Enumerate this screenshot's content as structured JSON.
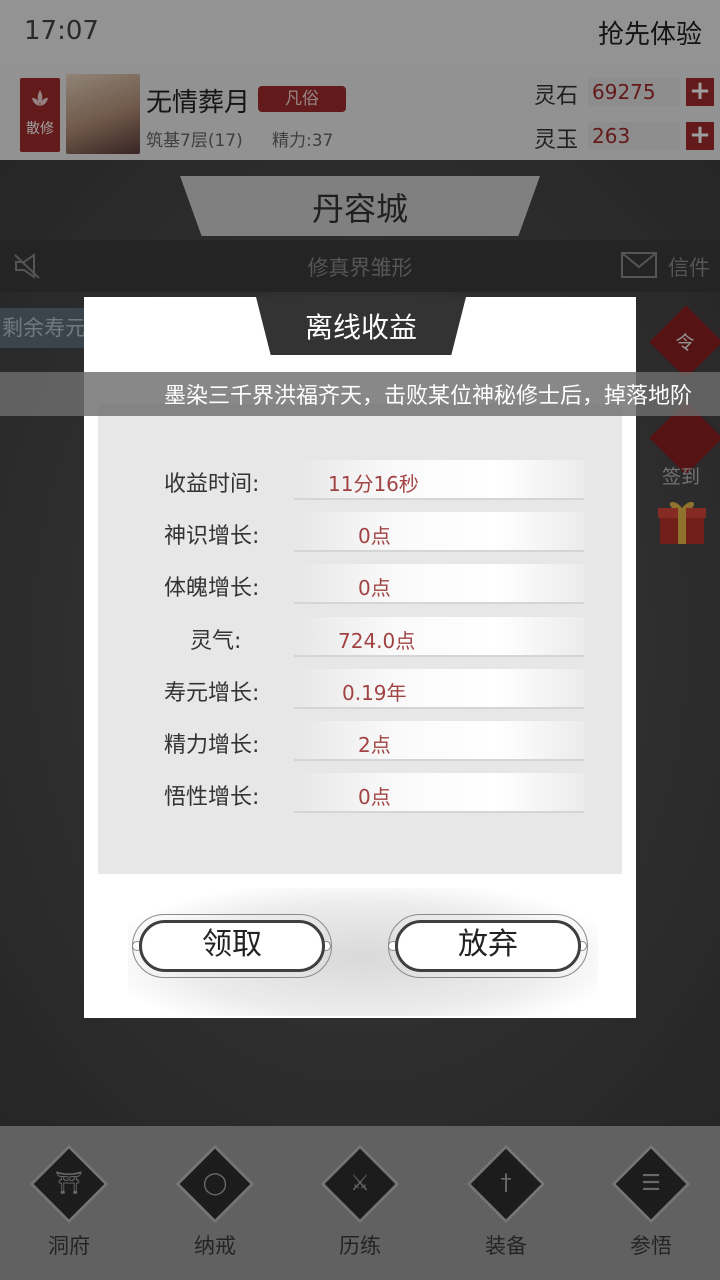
{
  "status_bar": {
    "time": "17:07",
    "preview_label": "抢先体验"
  },
  "player": {
    "sect": "散修",
    "name": "无情葬月",
    "rank": "凡俗",
    "realm": "筑基7层(17)",
    "energy": "精力:37"
  },
  "currency": {
    "stone_label": "灵石",
    "stone_value": "69275",
    "jade_label": "灵玉",
    "jade_value": "263",
    "add_symbol": "+"
  },
  "map": {
    "city_name": "丹容城",
    "news_title": "修真界雏形",
    "mail_label": "信件",
    "life_tag": "剩余寿元",
    "side_order": "令",
    "side_checkin": "签到"
  },
  "ticker": {
    "text": "墨染三千界洪福齐天，击败某位神秘修士后，掉落地阶"
  },
  "dialog": {
    "title": "离线收益",
    "rows": [
      {
        "label": "收益时间:",
        "value": "11分16秒"
      },
      {
        "label": "神识增长:",
        "value": "0点"
      },
      {
        "label": "体魄增长:",
        "value": "0点"
      },
      {
        "label": "灵气:",
        "value": "724.0点"
      },
      {
        "label": "寿元增长:",
        "value": "0.19年"
      },
      {
        "label": "精力增长:",
        "value": "2点"
      },
      {
        "label": "悟性增长:",
        "value": "0点"
      }
    ],
    "claim_label": "领取",
    "abandon_label": "放弃"
  },
  "nav": {
    "items": [
      {
        "label": "洞府",
        "icon": "cave-icon"
      },
      {
        "label": "纳戒",
        "icon": "ring-icon"
      },
      {
        "label": "历练",
        "icon": "swords-icon"
      },
      {
        "label": "装备",
        "icon": "dagger-icon"
      },
      {
        "label": "参悟",
        "icon": "book-icon"
      }
    ]
  },
  "colors": {
    "accent": "#a12a2a",
    "value_text": "#a24343",
    "panel": "#e7e7e7"
  }
}
